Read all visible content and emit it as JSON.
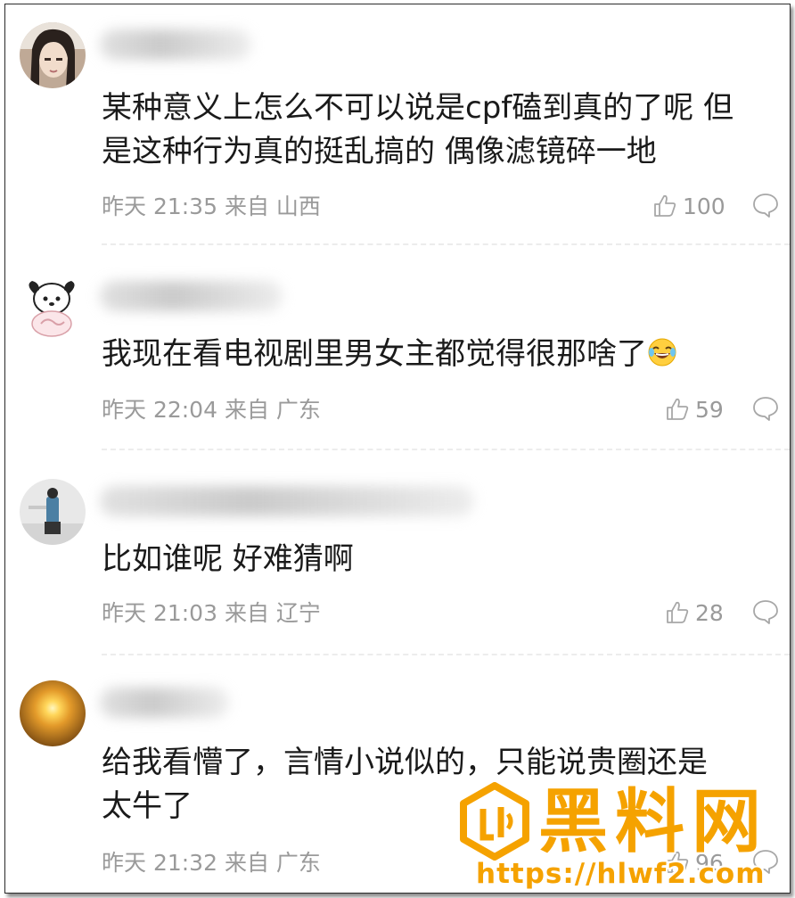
{
  "comments": [
    {
      "text": "某种意义上怎么不可以说是cpf磕到真的了呢 但\n是这种行为真的挺乱搞的 偶像滤镜碎一地",
      "meta": "昨天 21:35 来自 山西",
      "likes": "100"
    },
    {
      "text": "我现在看电视剧里男女主都觉得很那啥了",
      "meta": "昨天 22:04 来自 广东",
      "likes": "59"
    },
    {
      "text": "比如谁呢 好难猜啊",
      "meta": "昨天 21:03 来自 辽宁",
      "likes": "28"
    },
    {
      "text": "给我看懵了，言情小说似的，只能说贵圈还是\n太牛了",
      "meta": "昨天 21:32 来自 广东",
      "likes": "96"
    }
  ],
  "watermark": {
    "brand": "黑料网",
    "url": "https://hlwf2.com"
  },
  "icons": {
    "like": "thumbs-up-icon",
    "reply": "comment-bubble-icon",
    "emoji": "laughing-crying-emoji"
  },
  "colors": {
    "meta_text": "#9a9a9a",
    "body_text": "#1a1a1a",
    "watermark": "#f5a200"
  }
}
